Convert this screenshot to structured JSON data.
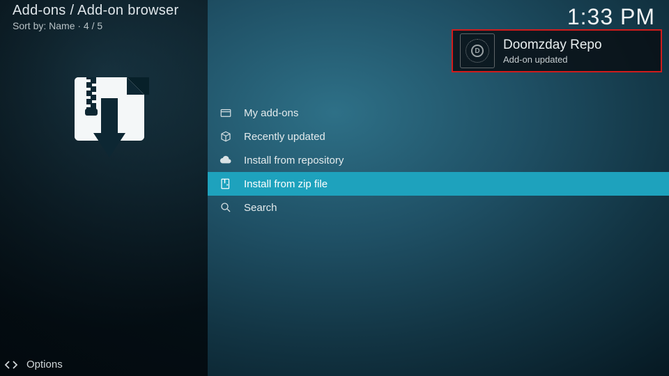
{
  "header": {
    "title": "Add-ons / Add-on browser",
    "sort_label": "Sort by: Name  ·  4 / 5"
  },
  "clock": "1:33 PM",
  "menu": {
    "items": [
      {
        "label": "My add-ons",
        "icon": "box-icon",
        "selected": false
      },
      {
        "label": "Recently updated",
        "icon": "package-icon",
        "selected": false
      },
      {
        "label": "Install from repository",
        "icon": "cloud-icon",
        "selected": false
      },
      {
        "label": "Install from zip file",
        "icon": "zip-icon",
        "selected": true
      },
      {
        "label": "Search",
        "icon": "search-icon",
        "selected": false
      }
    ]
  },
  "notification": {
    "title": "Doomzday Repo",
    "message": "Add-on updated"
  },
  "options_label": "Options"
}
